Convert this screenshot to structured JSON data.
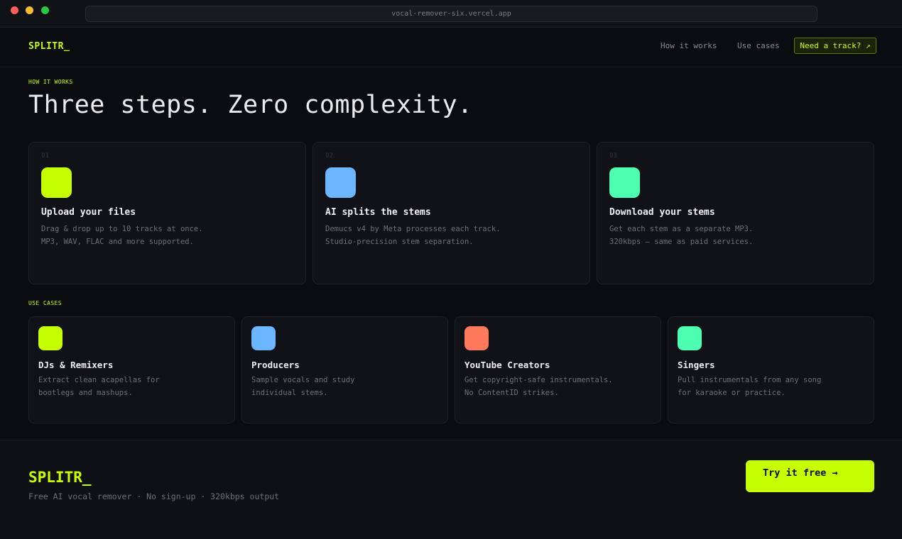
{
  "browser": {
    "url": "vocal-remover-six.vercel.app"
  },
  "nav": {
    "logo": "SPLITR_",
    "links": [
      "How it works",
      "Use cases"
    ],
    "cta": "Need a track? ↗"
  },
  "how": {
    "eyebrow": "HOW IT WORKS",
    "heading": "Three steps. Zero complexity.",
    "steps": [
      {
        "num": "01",
        "title": "Upload your files",
        "desc1": "Drag & drop up to 10 tracks at once.",
        "desc2": "MP3, WAV, FLAC and more supported.",
        "color": "#c6ff00"
      },
      {
        "num": "02",
        "title": "AI splits the stems",
        "desc1": "Demucs v4 by Meta processes each track.",
        "desc2": "Studio-precision stem separation.",
        "color": "#6cb6ff"
      },
      {
        "num": "03",
        "title": "Download your stems",
        "desc1": "Get each stem as a separate MP3.",
        "desc2": "320kbps — same as paid services.",
        "color": "#4dffb0"
      }
    ]
  },
  "use": {
    "eyebrow": "USE CASES",
    "cases": [
      {
        "title": "DJs & Remixers",
        "desc1": "Extract clean acapellas for",
        "desc2": "bootlegs and mashups.",
        "color": "#c6ff00"
      },
      {
        "title": "Producers",
        "desc1": "Sample vocals and study",
        "desc2": "individual stems.",
        "color": "#6cb6ff"
      },
      {
        "title": "YouTube Creators",
        "desc1": "Get copyright-safe instrumentals.",
        "desc2": "No ContentID strikes.",
        "color": "#ff7a5c"
      },
      {
        "title": "Singers",
        "desc1": "Pull instrumentals from any song",
        "desc2": "for karaoke or practice.",
        "color": "#4dffb0"
      }
    ]
  },
  "footer": {
    "logo": "SPLITR_",
    "tagline": "Free AI vocal remover · No sign-up · 320kbps output",
    "cta": "Try it free →"
  }
}
